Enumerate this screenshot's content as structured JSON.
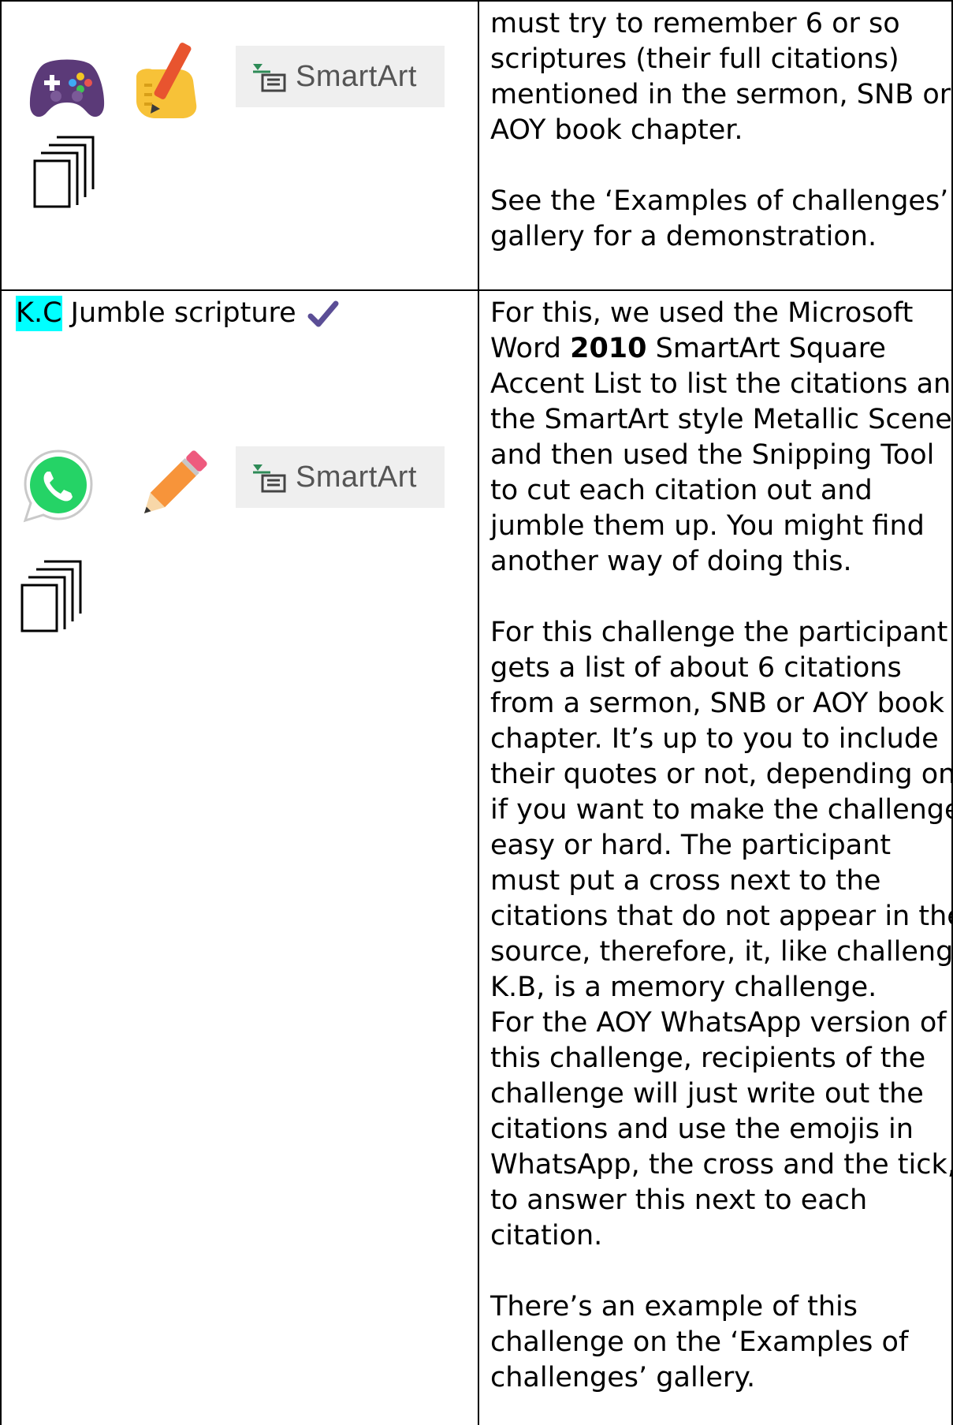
{
  "row1": {
    "icons": [
      "gamepad-icon",
      "writing-hand-icon",
      "smartart-icon",
      "pages-icon"
    ],
    "smartart_label": "SmartArt",
    "paragraphs": [
      [
        "must try to remember 6 or so",
        "scriptures (their full citations)",
        "mentioned in the sermon, SNB or",
        "AOY book chapter."
      ],
      [
        "See the ‘Examples of challenges’",
        "gallery for a demonstration."
      ]
    ]
  },
  "row2": {
    "code": "K.C",
    "title": " Jumble scripture",
    "icons": [
      "check-icon",
      "whatsapp-icon",
      "pencil-icon",
      "smartart-icon",
      "pages-icon"
    ],
    "smartart_label": "SmartArt",
    "intro": {
      "l1": "For this, we used the Microsoft",
      "l2_pre": "Word ",
      "l2_bold": "2010",
      "l2_post": " SmartArt Square",
      "rest": [
        "Accent List to list the citations and",
        "the SmartArt style Metallic Scene",
        "and then used the Snipping Tool",
        "to cut each citation out and",
        "jumble them up. You might find",
        "another way of doing this."
      ]
    },
    "para2": [
      "For this challenge the participant",
      "gets a list of about 6 citations",
      "from a sermon, SNB or AOY book",
      "chapter. It’s up to you to include",
      "their quotes or not, depending on",
      "if you want to make the challenge",
      "easy or hard.  The participant",
      "must put a cross next to the",
      "citations that do not appear in the",
      "source, therefore, it, like challenge",
      "K.B, is a memory challenge.",
      "For the AOY WhatsApp version of",
      "this challenge, recipients of the",
      "challenge will just write out the",
      "citations and use the emojis in",
      "WhatsApp, the cross and the tick,",
      "to answer this next to each",
      "citation."
    ],
    "para3": [
      "There’s an example of this",
      "challenge on the ‘Examples of",
      "challenges’ gallery."
    ]
  },
  "colors": {
    "highlight": "#00ffff",
    "check": "#5b4e96",
    "whatsapp": "#25d366",
    "gamepad": "#5b3a78",
    "pencil": "#f7943a"
  }
}
